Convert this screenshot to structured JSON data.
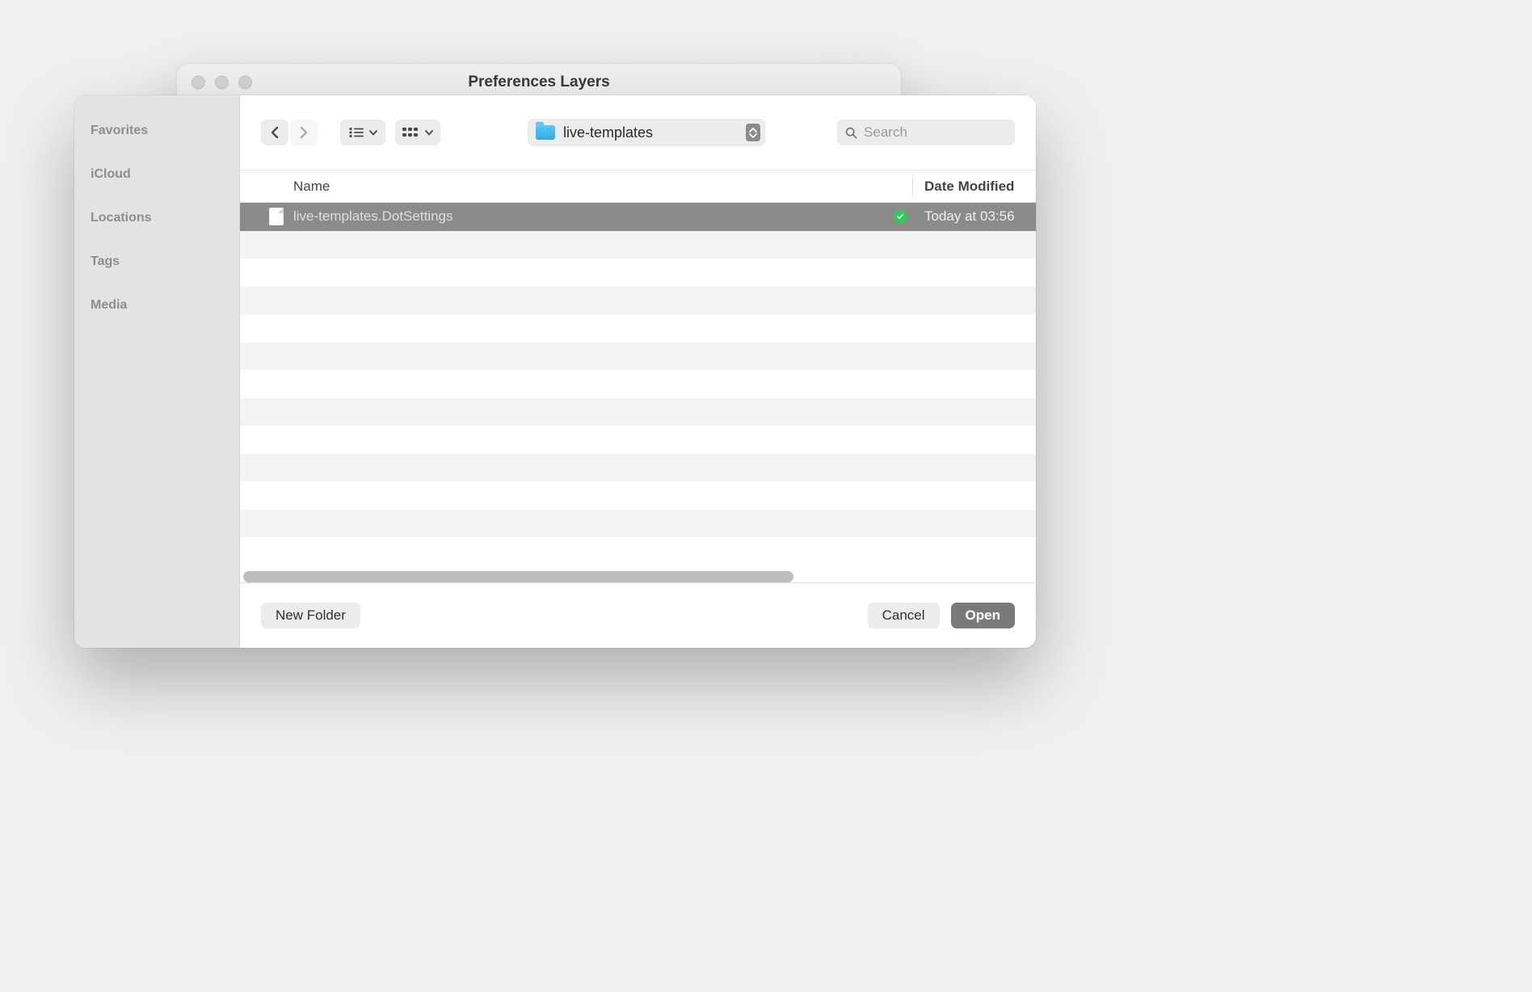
{
  "backWindow": {
    "title": "Preferences Layers"
  },
  "sidebar": {
    "sections": [
      {
        "label": "Favorites"
      },
      {
        "label": "iCloud"
      },
      {
        "label": "Locations"
      },
      {
        "label": "Tags"
      },
      {
        "label": "Media"
      }
    ]
  },
  "toolbar": {
    "currentFolder": "live-templates",
    "searchPlaceholder": "Search"
  },
  "columns": {
    "name": "Name",
    "dateModified": "Date Modified"
  },
  "files": [
    {
      "name": "live-templates.DotSettings",
      "dateModified": "Today at 03:56",
      "selected": true,
      "synced": true
    }
  ],
  "listRowCount": 13,
  "buttons": {
    "newFolder": "New Folder",
    "cancel": "Cancel",
    "open": "Open"
  }
}
